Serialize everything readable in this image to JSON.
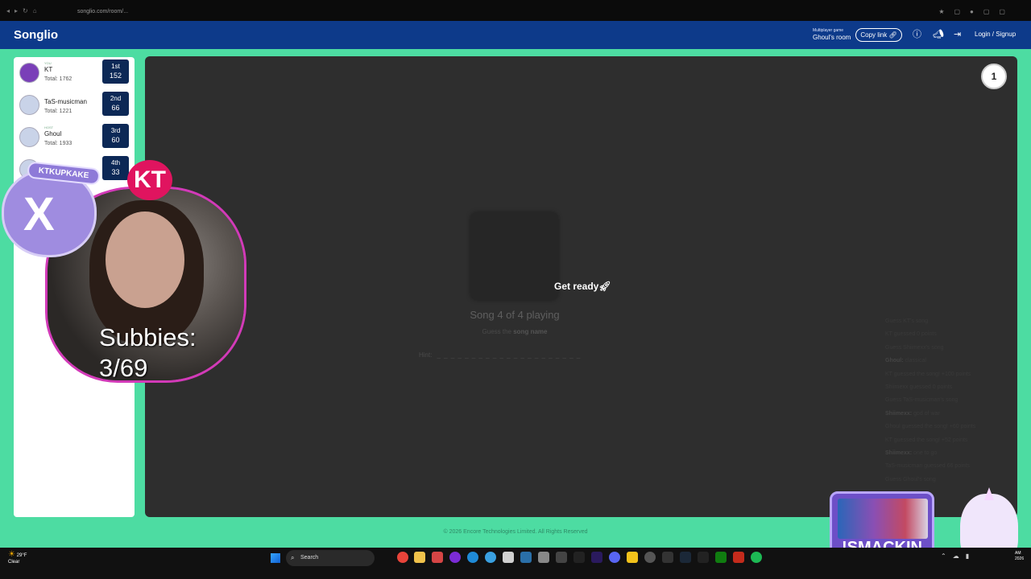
{
  "browser": {
    "url": "songlio.com/room/..."
  },
  "header": {
    "logo": "Songlio",
    "room_subtitle": "Multiplayer game",
    "room_name": "Ghoul's room",
    "copy_link_label": "Copy link",
    "login_label": "Login / Signup"
  },
  "scoreboard": {
    "players": [
      {
        "role": "YOU",
        "name": "KT",
        "total": "Total: 1762",
        "place": "1st",
        "points": "152"
      },
      {
        "role": "",
        "name": "TaS-musicman",
        "total": "Total: 1221",
        "place": "2nd",
        "points": "66"
      },
      {
        "role": "HOST",
        "name": "Ghoul",
        "total": "Total: 1933",
        "place": "3rd",
        "points": "60"
      },
      {
        "role": "",
        "name": "",
        "total": "",
        "place": "4th",
        "points": "33"
      }
    ]
  },
  "game": {
    "round": "1",
    "get_ready": "Get ready",
    "status": "Song 4 of 4 playing",
    "guess_prefix": "Guess the",
    "guess_target": "song name",
    "hint_label": "Hint:",
    "hint_blanks": "_ _ _ _ _ _ _ _    _ _ _ _ _ _    _ _ _    _ _ _ _"
  },
  "chat": [
    {
      "who": "",
      "text": "Guess KT's song"
    },
    {
      "who": "",
      "text": "KT guessed 0 points"
    },
    {
      "who": "",
      "text": "Guess Shiimexx's song"
    },
    {
      "who": "Ghoul:",
      "text": "classical"
    },
    {
      "who": "",
      "text": "KT guessed the song! +100 points"
    },
    {
      "who": "",
      "text": "Shiimexx guessed 0 points"
    },
    {
      "who": "",
      "text": "Guess TaS-musicman's song"
    },
    {
      "who": "Shiimexx:",
      "text": "god of war"
    },
    {
      "who": "",
      "text": "Ghoul guessed the song! +60 points"
    },
    {
      "who": "",
      "text": "KT guessed the song! +52 points"
    },
    {
      "who": "Shiimexx:",
      "text": "one to go"
    },
    {
      "who": "",
      "text": "TaS-musicman guessed 66 points"
    },
    {
      "who": "",
      "text": "Guess Ghoul's song"
    }
  ],
  "footer": "© 2026 Encore Technologies Limited. All Rights Reserved",
  "overlay": {
    "handle": "KTKUPKAKE",
    "x_glyph": "X",
    "kt_badge": "KT",
    "subbies": "Subbies:",
    "subbies_count": "3/69",
    "smack": "!SMACKIN"
  },
  "taskbar": {
    "temp": "29°F",
    "condition": "Clear",
    "search_label": "Search",
    "clock_time": "AM",
    "clock_date": "2026"
  }
}
